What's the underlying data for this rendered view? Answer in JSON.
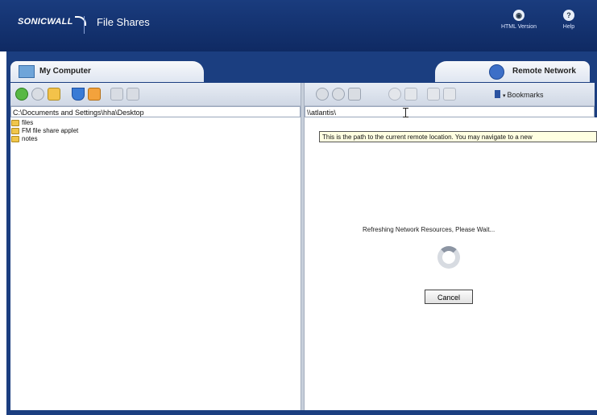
{
  "header": {
    "logo_text": "SONICWALL",
    "app_title": "File Shares",
    "links": [
      {
        "label": "HTML Version",
        "icon": "html-version-icon"
      },
      {
        "label": "Help",
        "icon": "help-icon"
      }
    ]
  },
  "tabs": {
    "left": {
      "label": "My Computer",
      "icon": "computer-icon"
    },
    "right": {
      "label": "Remote Network",
      "icon": "globe-icon"
    }
  },
  "toolbar": {
    "bookmarks_label": "Bookmarks"
  },
  "local": {
    "path": "C:\\Documents and Settings\\hha\\Desktop",
    "files": [
      {
        "name": "files"
      },
      {
        "name": "FM file share applet"
      },
      {
        "name": "notes"
      }
    ]
  },
  "remote": {
    "path": "\\\\atlantis\\",
    "tooltip": "This is the path to the current remote location.  You may navigate to a new",
    "loading_text": "Refreshing Network Resources, Please Wait...",
    "cancel_label": "Cancel"
  },
  "colors": {
    "header_bg": "#14326f",
    "frame_bg": "#1b3e80",
    "tooltip_bg": "#ffffe1"
  }
}
